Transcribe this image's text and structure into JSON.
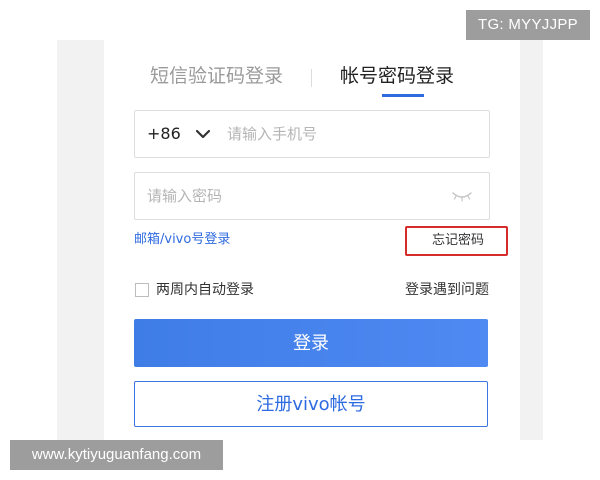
{
  "badge": {
    "text": "TG: MYYJJPP"
  },
  "tabs": [
    {
      "label": "短信验证码登录",
      "active": false
    },
    {
      "label": "帐号密码登录",
      "active": true
    }
  ],
  "phone": {
    "country_code": "+86",
    "placeholder": "请输入手机号",
    "dropdown_icon": "chevron-down-icon"
  },
  "password": {
    "placeholder": "请输入密码",
    "toggle_icon": "eye-closed-icon"
  },
  "links": {
    "email_vivo": "邮箱/vivo号登录",
    "forgot_password": "忘记密码",
    "login_problem": "登录遇到问题"
  },
  "auto_login": {
    "label": "两周内自动登录",
    "checked": false
  },
  "buttons": {
    "login": "登录",
    "register": "注册vivo帐号"
  },
  "watermark": {
    "text": "www.kytiyuguanfang.com"
  },
  "colors": {
    "accent": "#2f6be0",
    "highlight_frame": "#d52b2b",
    "overlay_gray": "#9d9d9d"
  }
}
